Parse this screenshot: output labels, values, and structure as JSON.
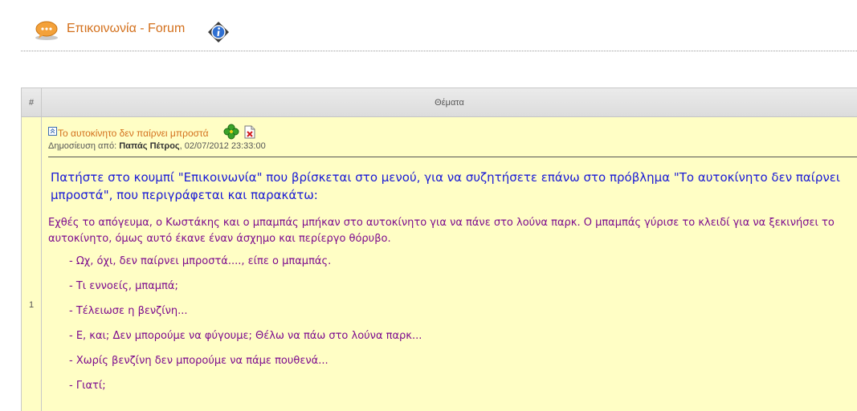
{
  "header": {
    "title": "Επικοινωνία - Forum",
    "icon_left": "chat-bubble-icon",
    "icon_right": "info-icon"
  },
  "table": {
    "col_num": "#",
    "col_topics": "Θέματα",
    "rows": [
      {
        "num": "1",
        "post": {
          "title": "Το αυτοκίνητο δεν παίρνει μπροστά",
          "meta_prefix": "Δημοσίευση από: ",
          "author": "Παπάς Πέτρος",
          "meta_date": ", 02/07/2012 23:33:00",
          "intro_line1": "Πατήστε στο κουμπί \"Επικοινωνία\" που βρίσκεται στο μενού, για να συζητήσετε επάνω στο πρόβλημα \"Το αυτοκίνητο δεν παίρνει",
          "intro_line2": "μπροστά\", που περιγράφεται και παρακάτω:",
          "story": "Εχθές το απόγευμα, ο Κωστάκης και ο μπαμπάς μπήκαν στο αυτοκίνητο για να πάνε στο λούνα παρκ. Ο μπαμπάς γύρισε το κλειδί για να ξεκινήσει το αυτοκίνητο, όμως αυτό έκανε έναν άσχημο και περίεργο θόρυβο.",
          "dialog": [
            "- Ωχ, όχι, δεν παίρνει μπροστά...., είπε ο μπαμπάς.",
            "- Τι εννοείς, μπαμπά;",
            "- Τέλειωσε η βενζίνη...",
            "- Ε, και; Δεν μπορούμε να φύγουμε; Θέλω να πάω στο λούνα παρκ...",
            "- Χωρίς βενζίνη δεν μπορούμε να πάμε πουθενά...",
            "- Γιατί;"
          ]
        }
      }
    ]
  },
  "colors": {
    "title": "#d3701c",
    "intro_text": "#1a1ad6",
    "story_text": "#7d0b8e",
    "row_background": "#fffec5"
  }
}
